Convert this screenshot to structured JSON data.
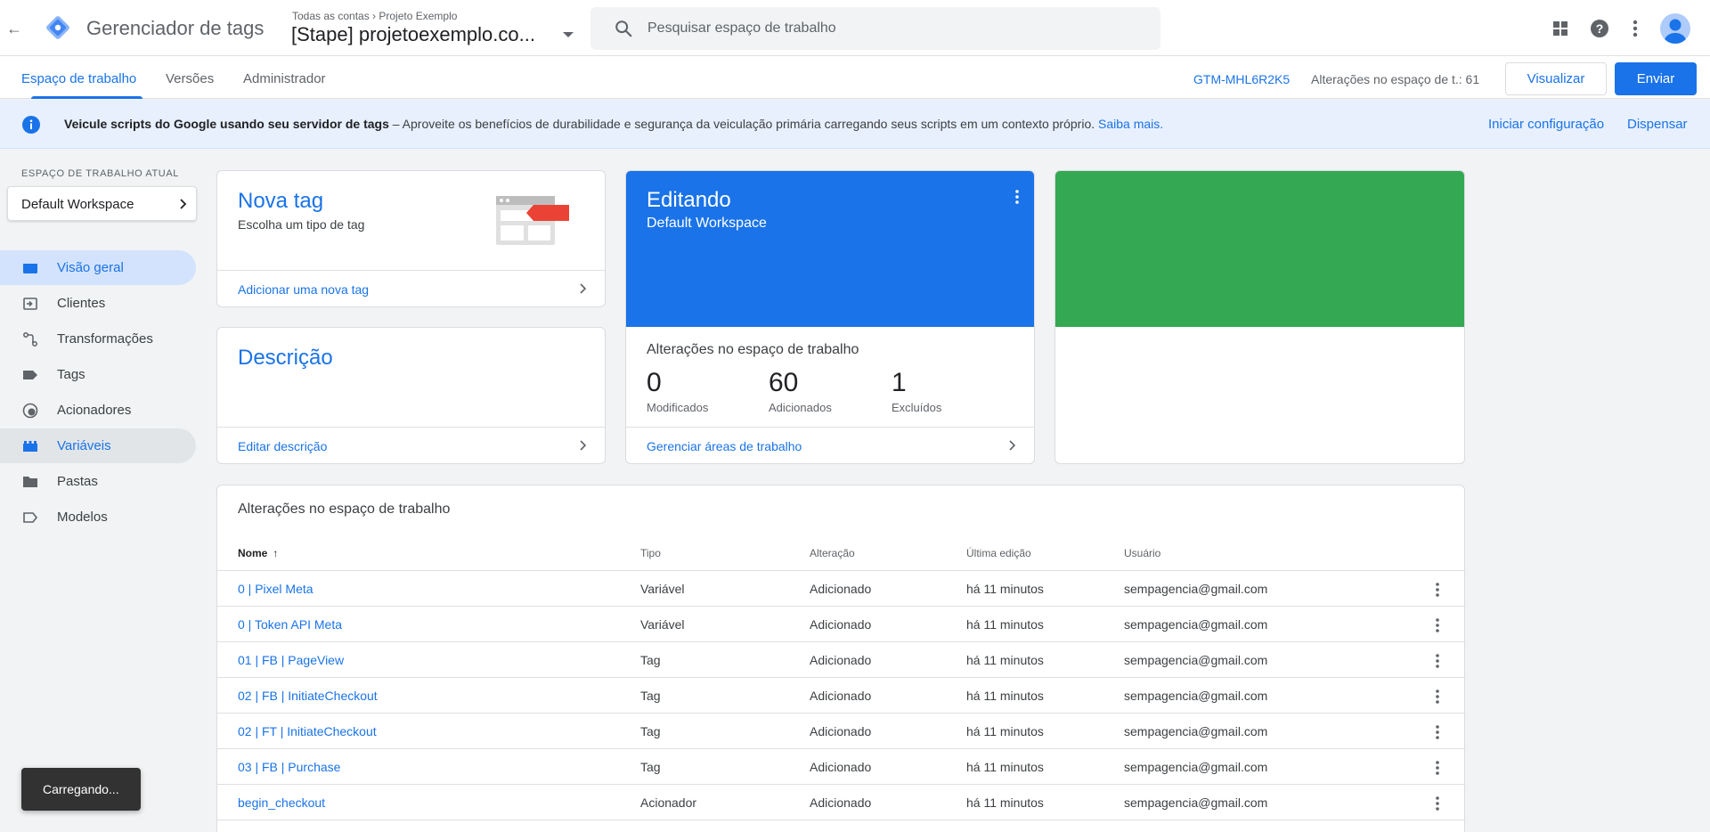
{
  "header": {
    "back_label": "←",
    "app_title": "Gerenciador de tags",
    "breadcrumb_top": "Todas as contas › Projeto Exemplo",
    "container_name": "[Stape] projetoexemplo.co...",
    "search_placeholder": "Pesquisar espaço de trabalho",
    "icons": [
      "apps-grid-icon",
      "help-icon",
      "more-vert-icon",
      "account-avatar-icon"
    ]
  },
  "tabs": [
    {
      "label": "Espaço de trabalho",
      "active": true
    },
    {
      "label": "Versões",
      "active": false
    },
    {
      "label": "Administrador",
      "active": false
    }
  ],
  "toolbar": {
    "container_id": "GTM-MHL6R2K5",
    "workspace_changes": "Alterações no espaço de t.: 61",
    "preview_label": "Visualizar",
    "submit_label": "Enviar"
  },
  "banner": {
    "bold_text": "Veicule scripts do Google usando seu servidor de tags",
    "body_text": " – Aproveite os benefícios de durabilidade e segurança da veiculação primária carregando seus scripts em um contexto próprio. ",
    "learn_more": "Saiba mais.",
    "setup_action": "Iniciar configuração",
    "dismiss_action": "Dispensar"
  },
  "sidebar": {
    "workspace_label": "ESPAÇO DE TRABALHO ATUAL",
    "workspace_name": "Default Workspace",
    "items": [
      {
        "label": "Visão geral",
        "icon": "overview-icon",
        "state": "active"
      },
      {
        "label": "Clientes",
        "icon": "clients-icon",
        "state": ""
      },
      {
        "label": "Transformações",
        "icon": "transformations-icon",
        "state": ""
      },
      {
        "label": "Tags",
        "icon": "tag-icon",
        "state": ""
      },
      {
        "label": "Acionadores",
        "icon": "trigger-icon",
        "state": ""
      },
      {
        "label": "Variáveis",
        "icon": "variables-icon",
        "state": "hover"
      },
      {
        "label": "Pastas",
        "icon": "folder-icon",
        "state": ""
      },
      {
        "label": "Modelos",
        "icon": "template-icon",
        "state": ""
      }
    ]
  },
  "new_tag_card": {
    "title": "Nova tag",
    "subtitle": "Escolha um tipo de tag",
    "footer": "Adicionar uma nova tag"
  },
  "description_card": {
    "title": "Descrição",
    "footer": "Editar descrição"
  },
  "editing_card": {
    "title": "Editando",
    "workspace": "Default Workspace",
    "stats_title": "Alterações no espaço de trabalho",
    "stats": [
      {
        "value": "0",
        "label": "Modificados"
      },
      {
        "value": "60",
        "label": "Adicionados"
      },
      {
        "value": "1",
        "label": "Excluídos"
      }
    ],
    "footer": "Gerenciar áreas de trabalho"
  },
  "colors": {
    "accent": "#1a73e8",
    "editing_bg": "#1a73e8",
    "green_card": "#34a853"
  },
  "changes_table": {
    "title": "Alterações no espaço de trabalho",
    "columns": [
      "Nome",
      "Tipo",
      "Alteração",
      "Última edição",
      "Usuário"
    ],
    "sort_indicator": "↑",
    "rows": [
      {
        "name": "0 | Pixel Meta",
        "type": "Variável",
        "change": "Adicionado",
        "edited": "há 11 minutos",
        "user": "sempagencia@gmail.com"
      },
      {
        "name": "0 | Token API Meta",
        "type": "Variável",
        "change": "Adicionado",
        "edited": "há 11 minutos",
        "user": "sempagencia@gmail.com"
      },
      {
        "name": "01 | FB | PageView",
        "type": "Tag",
        "change": "Adicionado",
        "edited": "há 11 minutos",
        "user": "sempagencia@gmail.com"
      },
      {
        "name": "02 | FB | InitiateCheckout",
        "type": "Tag",
        "change": "Adicionado",
        "edited": "há 11 minutos",
        "user": "sempagencia@gmail.com"
      },
      {
        "name": "02 | FT | InitiateCheckout",
        "type": "Tag",
        "change": "Adicionado",
        "edited": "há 11 minutos",
        "user": "sempagencia@gmail.com"
      },
      {
        "name": "03 | FB | Purchase",
        "type": "Tag",
        "change": "Adicionado",
        "edited": "há 11 minutos",
        "user": "sempagencia@gmail.com"
      },
      {
        "name": "begin_checkout",
        "type": "Acionador",
        "change": "Adicionado",
        "edited": "há 11 minutos",
        "user": "sempagencia@gmail.com"
      }
    ]
  },
  "snackbar": {
    "label": "Carregando..."
  }
}
